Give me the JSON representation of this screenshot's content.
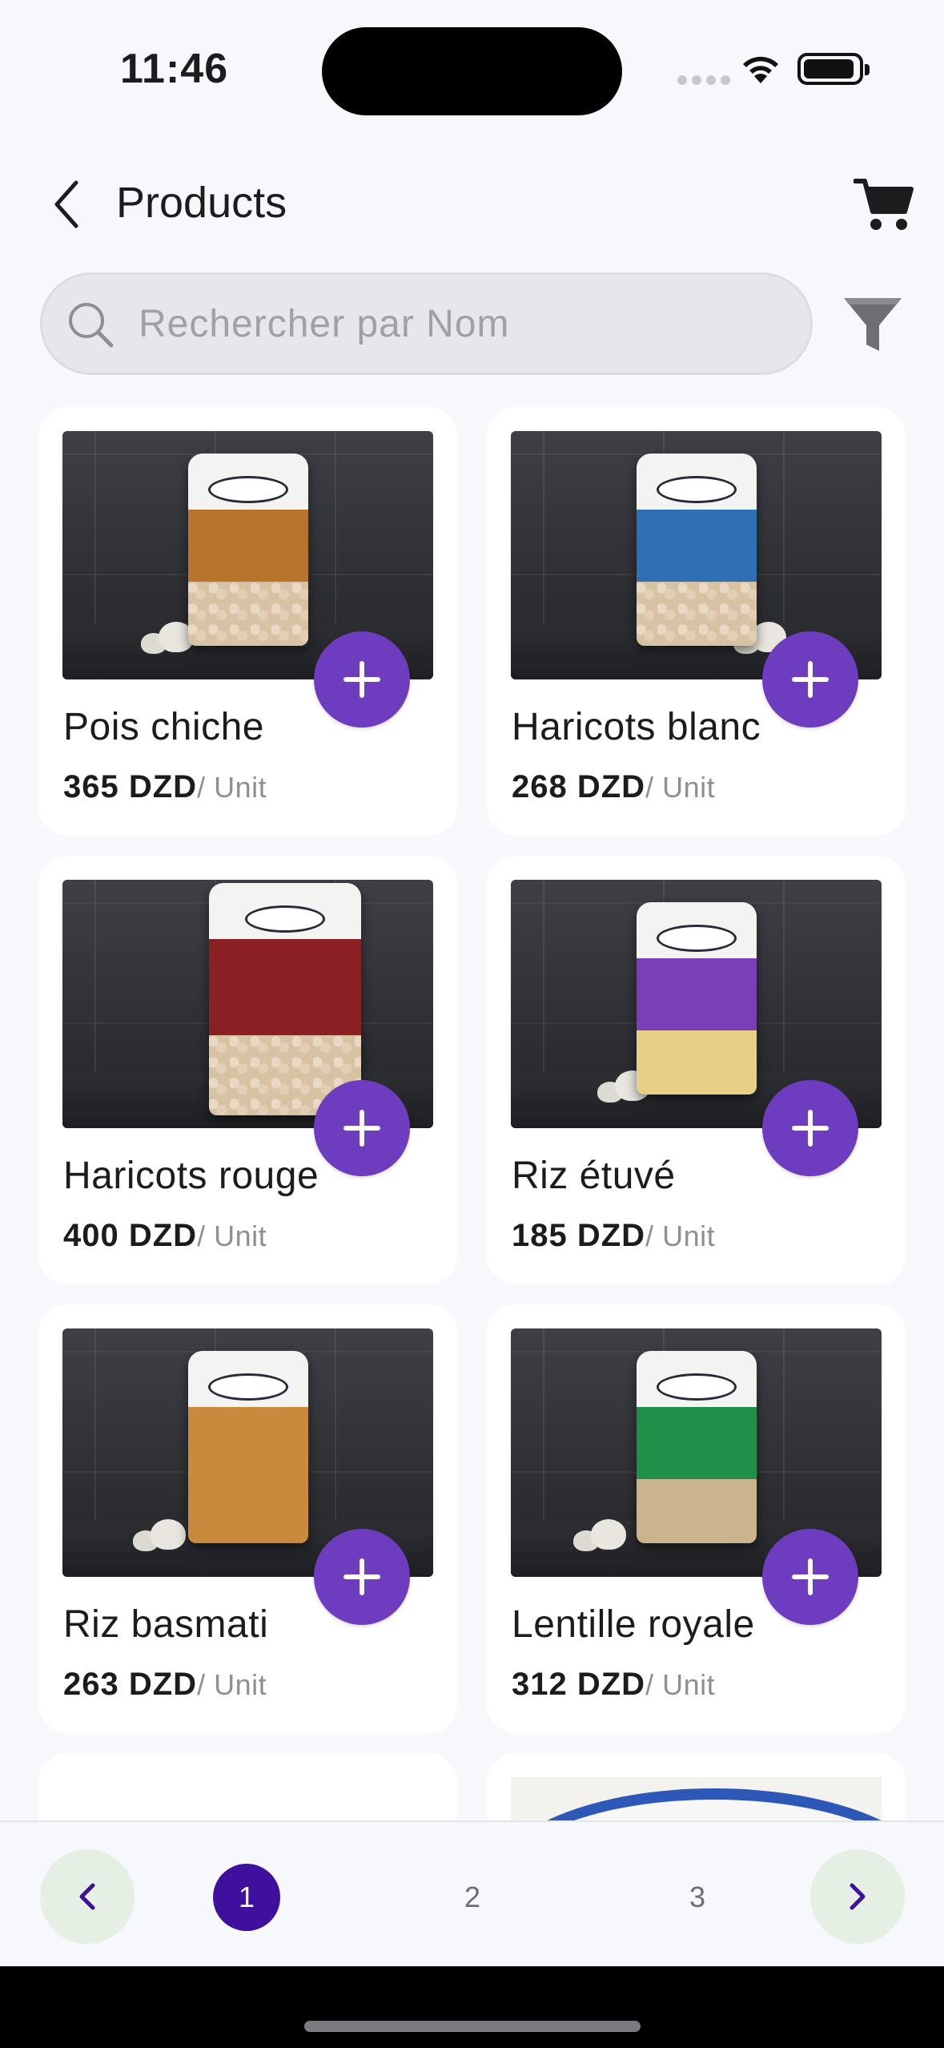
{
  "status_bar": {
    "time": "11:46"
  },
  "header": {
    "title": "Products"
  },
  "search": {
    "placeholder": "Rechercher par Nom",
    "value": ""
  },
  "products": [
    {
      "name": "Pois chiche",
      "price": "365 DZD",
      "unit": "/ Unit",
      "band_color": "#b8732d"
    },
    {
      "name": "Haricots blanc",
      "price": "268 DZD",
      "unit": "/ Unit",
      "band_color": "#2f6fb3"
    },
    {
      "name": "Haricots rouge",
      "price": "400 DZD",
      "unit": "/ Unit",
      "band_color": "#8a1f24"
    },
    {
      "name": "Riz étuvé",
      "price": "185 DZD",
      "unit": "/ Unit",
      "band_color": "#7a3fb8"
    },
    {
      "name": "Riz basmati",
      "price": "263 DZD",
      "unit": "/ Unit",
      "band_color": "#c98a3d"
    },
    {
      "name": "Lentille royale",
      "price": "312 DZD",
      "unit": "/ Unit",
      "band_color": "#1f8f4a"
    }
  ],
  "pagination": {
    "pages": [
      "1",
      "2",
      "3"
    ],
    "current": "1"
  },
  "colors": {
    "accent": "#6d3cbf",
    "active_page": "#3f0f9e",
    "arrow_bg": "#e6efe3"
  }
}
